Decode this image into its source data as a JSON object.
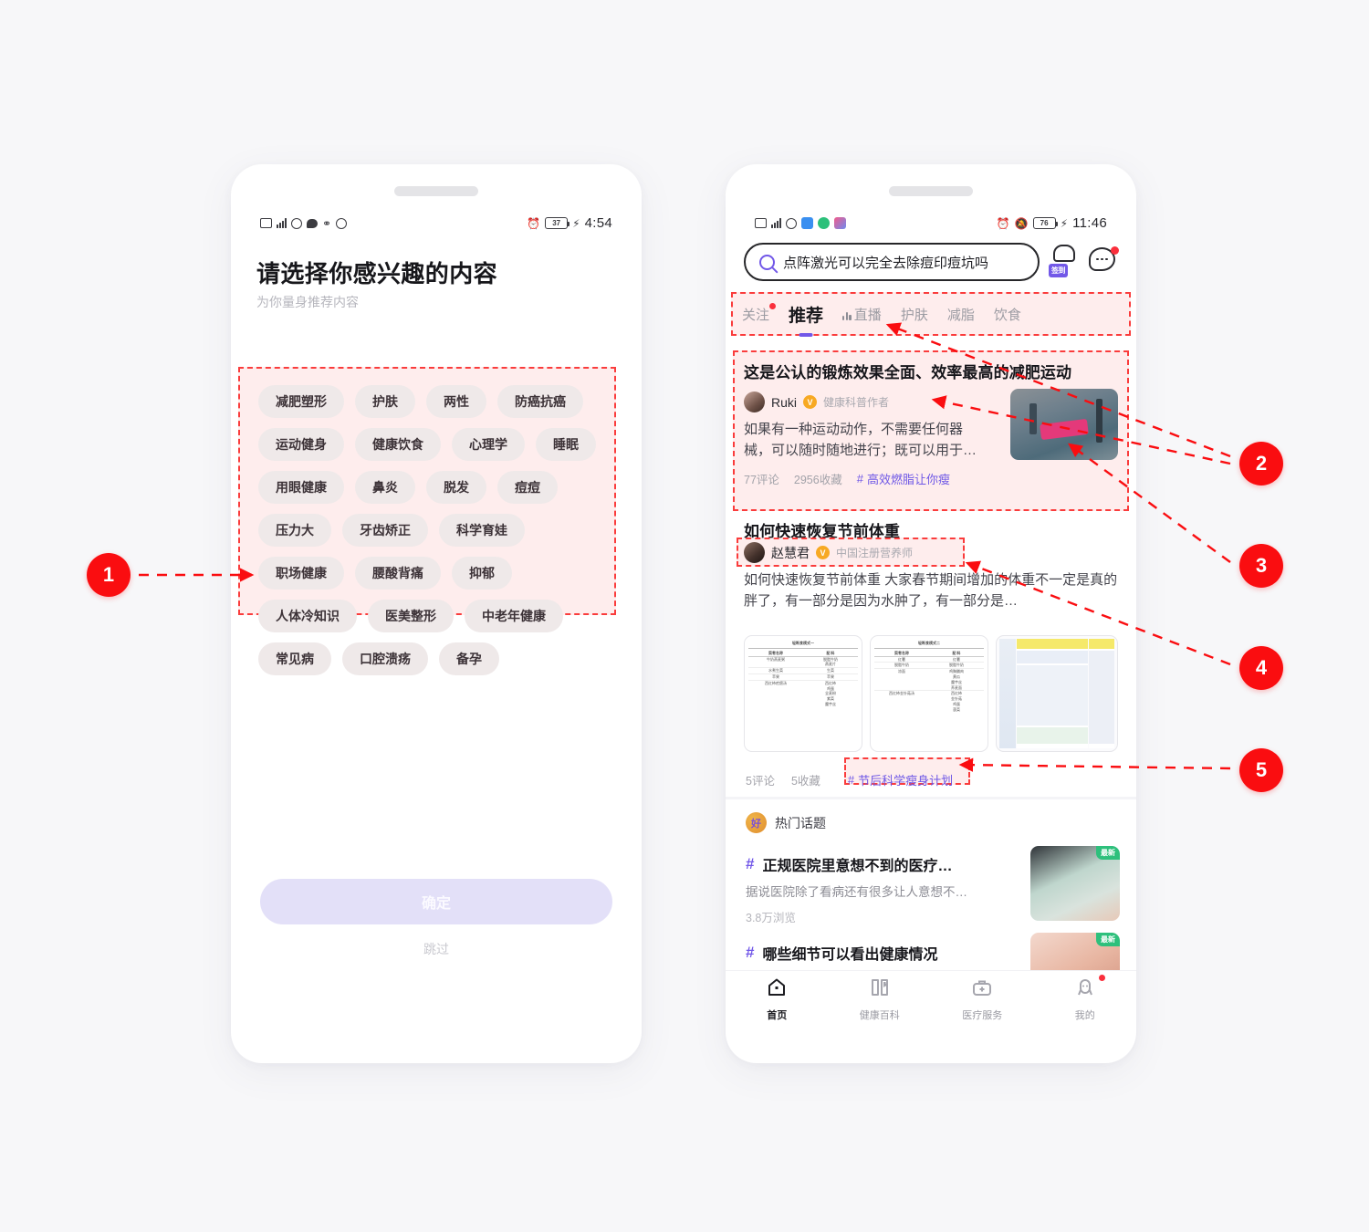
{
  "left_phone": {
    "status_bar": {
      "time": "4:54",
      "battery": "37"
    },
    "title": "请选择你感兴趣的内容",
    "subtitle": "为你量身推荐内容",
    "tags": [
      "减肥塑形",
      "护肤",
      "两性",
      "防癌抗癌",
      "运动健身",
      "健康饮食",
      "心理学",
      "睡眠",
      "用眼健康",
      "鼻炎",
      "脱发",
      "痘痘",
      "压力大",
      "牙齿矫正",
      "科学育娃",
      "职场健康",
      "腰酸背痛",
      "抑郁",
      "人体冷知识",
      "医美整形",
      "中老年健康",
      "常见病",
      "口腔溃疡",
      "备孕"
    ],
    "confirm_label": "确定",
    "skip_label": "跳过"
  },
  "right_phone": {
    "status_bar": {
      "time": "11:46",
      "battery": "76"
    },
    "search": {
      "query": "点阵激光可以完全去除痘印痘坑吗",
      "sign_in_badge": "签到"
    },
    "tabs": [
      {
        "label": "关注",
        "active": false,
        "has_dot": true
      },
      {
        "label": "推荐",
        "active": true,
        "has_dot": false
      },
      {
        "label": "直播",
        "active": false,
        "has_dot": false,
        "live_icon": true
      },
      {
        "label": "护肤",
        "active": false,
        "has_dot": false
      },
      {
        "label": "减脂",
        "active": false,
        "has_dot": false
      },
      {
        "label": "饮食",
        "active": false,
        "has_dot": false
      }
    ],
    "feed": [
      {
        "title": "这是公认的锻炼效果全面、效率最高的减肥运动",
        "author": "Ruki",
        "author_title": "健康科普作者",
        "verified_badge": "V",
        "excerpt": "如果有一种运动动作，不需要任何器械，可以随时随地进行；既可以用于…",
        "comments": "77评论",
        "collects": "2956收藏",
        "hashtag": "高效燃脂让你瘦"
      },
      {
        "title": "如何快速恢复节前体重",
        "author": "赵慧君",
        "author_title": "中国注册营养师",
        "verified_badge": "V",
        "excerpt": "如何快速恢复节前体重 大家春节期间增加的体重不一定是真的胖了，有一部分是因为水肿了，有一部分是…",
        "comments": "5评论",
        "collects": "5收藏",
        "hashtag": "节后科学瘦身计划"
      }
    ],
    "hot_topics": {
      "section_label": "热门话题",
      "items": [
        {
          "title": "正规医院里意想不到的医疗…",
          "desc": "据说医院除了看病还有很多让人意想不…",
          "views": "3.8万浏览",
          "badge": "最新"
        },
        {
          "title": "哪些细节可以看出健康情况",
          "desc": "",
          "views": "",
          "badge": "最新"
        }
      ]
    },
    "bottom_nav": [
      {
        "label": "首页",
        "icon": "home-icon",
        "active": true,
        "dot": false
      },
      {
        "label": "健康百科",
        "icon": "book-icon",
        "active": false,
        "dot": false
      },
      {
        "label": "医疗服务",
        "icon": "medical-kit-icon",
        "active": false,
        "dot": false
      },
      {
        "label": "我的",
        "icon": "profile-icon",
        "active": false,
        "dot": true
      }
    ]
  },
  "annotations": {
    "markers": [
      "1",
      "2",
      "3",
      "4",
      "5"
    ],
    "highlight_color": "#fa3c3c",
    "marker_color": "#fa0d10"
  }
}
